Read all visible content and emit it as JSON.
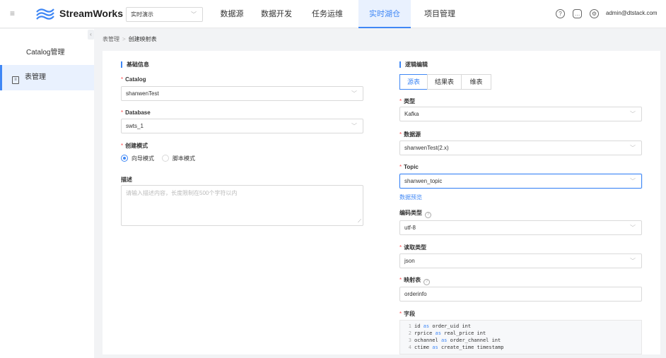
{
  "header": {
    "brand": "StreamWorks",
    "project": "实时演示",
    "nav": [
      "数据源",
      "数据开发",
      "任务运维",
      "实时湖仓",
      "项目管理"
    ],
    "active_nav": "实时湖仓",
    "user": "admin@dtstack.com",
    "icons": [
      "help-icon",
      "message-icon",
      "settings-icon"
    ]
  },
  "sidebar": {
    "items": [
      {
        "label": "Catalog管理",
        "active": false
      },
      {
        "label": "表管理",
        "active": true,
        "icon": "table-icon"
      }
    ]
  },
  "breadcrumb": {
    "parent": "表管理",
    "current": "创建映射表"
  },
  "basic": {
    "title": "基础信息",
    "catalog_label": "Catalog",
    "catalog_value": "shanwenTest",
    "database_label": "Database",
    "database_value": "swts_1",
    "mode_label": "创建模式",
    "mode_guided": "向导模式",
    "mode_script": "脚本模式",
    "desc_label": "描述",
    "desc_placeholder": "请输入描述内容，长度限制在500个字符以内"
  },
  "logic": {
    "title": "逻辑编辑",
    "tabs": [
      "源表",
      "结果表",
      "维表"
    ],
    "type_label": "类型",
    "type_value": "Kafka",
    "source_label": "数据源",
    "source_value": "shanwenTest(2.x)",
    "topic_label": "Topic",
    "topic_value": "shanwen_topic",
    "preview_link": "数据预览",
    "encoding_label": "编码类型",
    "encoding_value": "utf-8",
    "read_label": "读取类型",
    "read_value": "json",
    "mapping_label": "映射表",
    "mapping_value": "orderinfo",
    "fields_label": "字段",
    "fields": [
      {
        "n": "1",
        "a": "id",
        "b": "order_uid int"
      },
      {
        "n": "2",
        "a": "rprice",
        "b": "real_price int"
      },
      {
        "n": "3",
        "a": "ochannel",
        "b": "order_channel int"
      },
      {
        "n": "4",
        "a": "ctime",
        "b": "create_time timestamp"
      }
    ],
    "as_keyword": "as"
  }
}
